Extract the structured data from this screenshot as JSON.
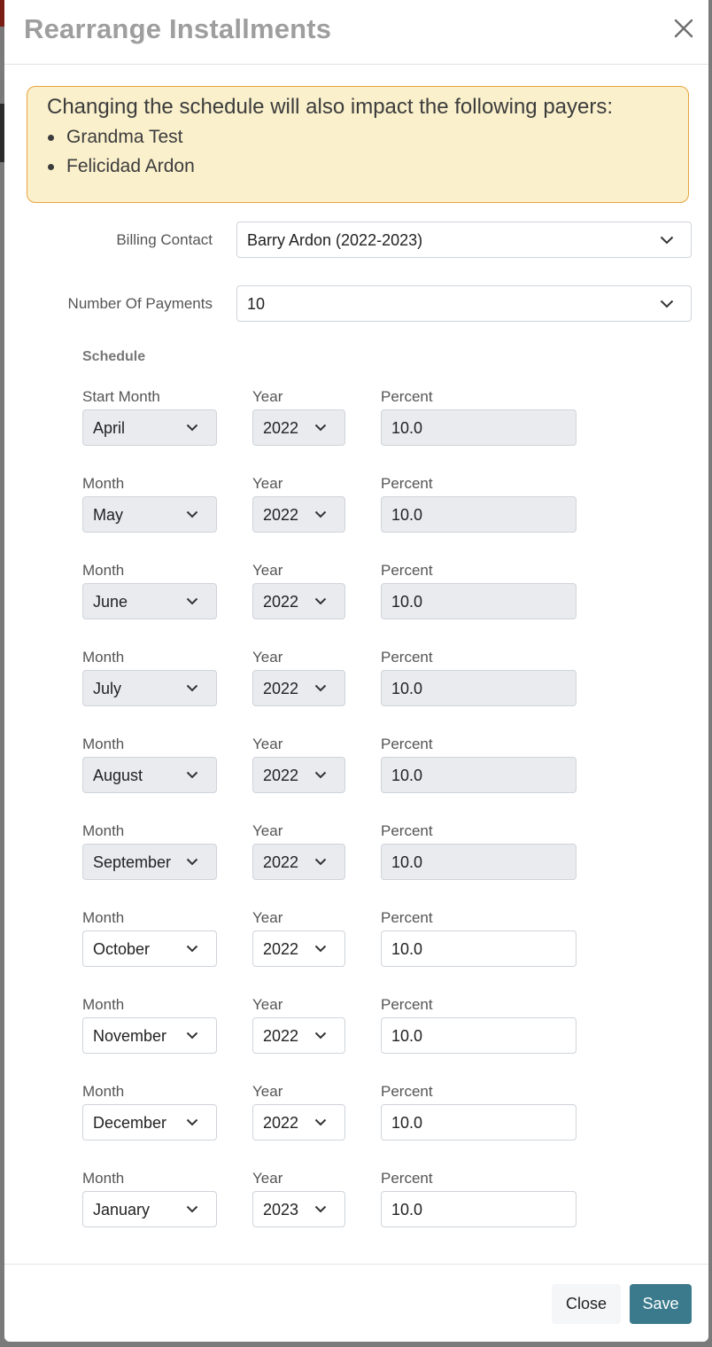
{
  "modal": {
    "title": "Rearrange Installments",
    "close_icon": "close-icon"
  },
  "alert": {
    "message": "Changing the schedule will also impact the following payers:",
    "payers": [
      "Grandma Test",
      "Felicidad Ardon"
    ]
  },
  "billing_contact": {
    "label": "Billing Contact",
    "value": "Barry Ardon (2022-2023)"
  },
  "number_of_payments": {
    "label": "Number Of Payments",
    "value": "10"
  },
  "schedule": {
    "title": "Schedule",
    "labels": {
      "start_month": "Start Month",
      "month": "Month",
      "year": "Year",
      "percent": "Percent"
    },
    "rows": [
      {
        "month_label": "Start Month",
        "month": "April",
        "year": "2022",
        "percent": "10.0",
        "disabled": true
      },
      {
        "month_label": "Month",
        "month": "May",
        "year": "2022",
        "percent": "10.0",
        "disabled": true
      },
      {
        "month_label": "Month",
        "month": "June",
        "year": "2022",
        "percent": "10.0",
        "disabled": true
      },
      {
        "month_label": "Month",
        "month": "July",
        "year": "2022",
        "percent": "10.0",
        "disabled": true
      },
      {
        "month_label": "Month",
        "month": "August",
        "year": "2022",
        "percent": "10.0",
        "disabled": true
      },
      {
        "month_label": "Month",
        "month": "September",
        "year": "2022",
        "percent": "10.0",
        "disabled": true
      },
      {
        "month_label": "Month",
        "month": "October",
        "year": "2022",
        "percent": "10.0",
        "disabled": false
      },
      {
        "month_label": "Month",
        "month": "November",
        "year": "2022",
        "percent": "10.0",
        "disabled": false
      },
      {
        "month_label": "Month",
        "month": "December",
        "year": "2022",
        "percent": "10.0",
        "disabled": false
      },
      {
        "month_label": "Month",
        "month": "January",
        "year": "2023",
        "percent": "10.0",
        "disabled": false
      }
    ]
  },
  "footer": {
    "close_label": "Close",
    "save_label": "Save"
  },
  "colors": {
    "primary": "#3b7a8c",
    "alert_bg": "#faf0cc",
    "alert_border": "#e8a33d",
    "disabled_bg": "#e9ebef"
  }
}
